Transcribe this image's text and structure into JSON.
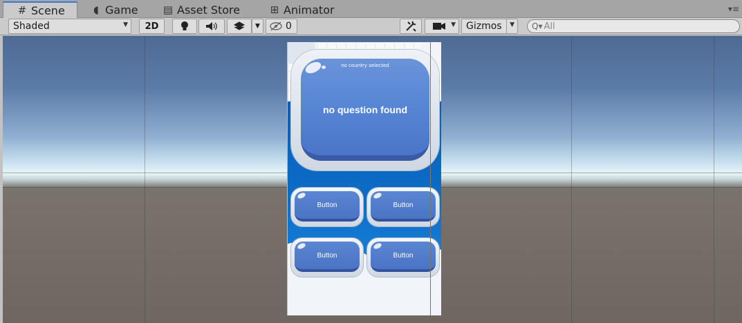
{
  "tabs": [
    {
      "label": "Scene",
      "icon": "scene-grid-icon"
    },
    {
      "label": "Game",
      "icon": "pacman-icon"
    },
    {
      "label": "Asset Store",
      "icon": "store-bag-icon"
    },
    {
      "label": "Animator",
      "icon": "animator-icon"
    }
  ],
  "toolbar": {
    "shading_mode": "Shaded",
    "mode_2d": "2D",
    "hidden_count": "0",
    "gizmos": "Gizmos",
    "search_placeholder": "All"
  },
  "game": {
    "country_text": "no country selected",
    "question_text": "no question found",
    "answers": [
      "Button",
      "Button",
      "Button",
      "Button"
    ]
  },
  "colors": {
    "active_tab_accent": "#3a79d8",
    "panel_blue": "#5887d6",
    "background_blue": "#0c6cc6"
  }
}
